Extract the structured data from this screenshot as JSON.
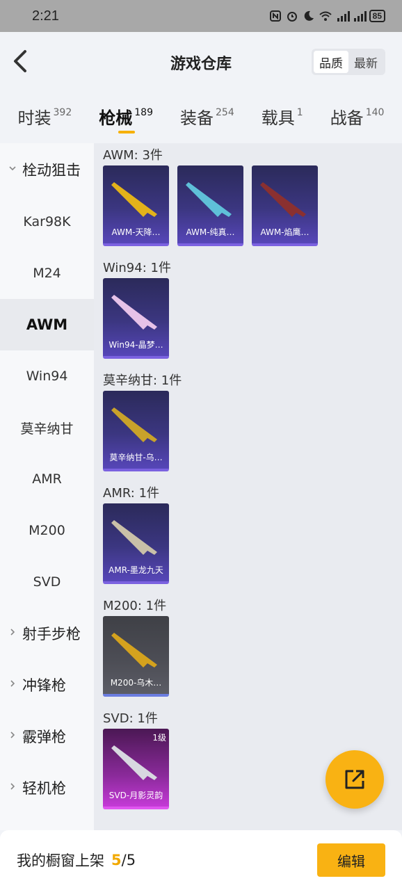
{
  "status_bar": {
    "time": "2:21",
    "battery": "85"
  },
  "header": {
    "title": "游戏仓库",
    "sort_options": [
      "品质",
      "最新"
    ],
    "active_sort": "品质"
  },
  "tabs": [
    {
      "label": "时装",
      "count": "392"
    },
    {
      "label": "枪械",
      "count": "189"
    },
    {
      "label": "装备",
      "count": "254"
    },
    {
      "label": "载具",
      "count": "1"
    },
    {
      "label": "战备",
      "count": "140"
    }
  ],
  "active_tab": "枪械",
  "sidebar": {
    "group_bolt": "栓动狙击",
    "items": [
      "Kar98K",
      "M24",
      "AWM",
      "Win94",
      "莫辛纳甘",
      "AMR",
      "M200",
      "SVD"
    ],
    "active_item": "AWM",
    "groups_collapsed": [
      "射手步枪",
      "冲锋枪",
      "霰弹枪",
      "轻机枪"
    ]
  },
  "sections": [
    {
      "title": "AWM: 3件",
      "items": [
        {
          "name": "AWM-天降…",
          "style": "purple",
          "gun_color": "#e3b21a"
        },
        {
          "name": "AWM-纯真…",
          "style": "purple",
          "gun_color": "#5fc0d8"
        },
        {
          "name": "AWM-焰鹰…",
          "style": "purple",
          "gun_color": "#8a3030"
        }
      ]
    },
    {
      "title": "Win94: 1件",
      "items": [
        {
          "name": "Win94-晶梦…",
          "style": "purple",
          "gun_color": "#e6c2e8"
        }
      ]
    },
    {
      "title": "莫辛纳甘: 1件",
      "items": [
        {
          "name": "莫辛纳甘-乌…",
          "style": "purple",
          "gun_color": "#c9a22a"
        }
      ]
    },
    {
      "title": "AMR: 1件",
      "items": [
        {
          "name": "AMR-墨龙九天",
          "style": "purple",
          "gun_color": "#c9c0a8"
        }
      ]
    },
    {
      "title": "M200: 1件",
      "items": [
        {
          "name": "M200-乌木…",
          "style": "gray",
          "gun_color": "#d4a21e"
        }
      ]
    },
    {
      "title": "SVD: 1件",
      "items": [
        {
          "name": "SVD-月影灵韵",
          "style": "pink",
          "gun_color": "#d8d8e0",
          "level": "1级"
        }
      ]
    }
  ],
  "footer": {
    "label": "我的橱窗上架",
    "used": "5",
    "separator": "/",
    "total": "5",
    "edit_label": "编辑"
  },
  "colors": {
    "accent": "#f9b213",
    "card_purple": "#3b3680",
    "card_pink": "#8a2a9a"
  }
}
